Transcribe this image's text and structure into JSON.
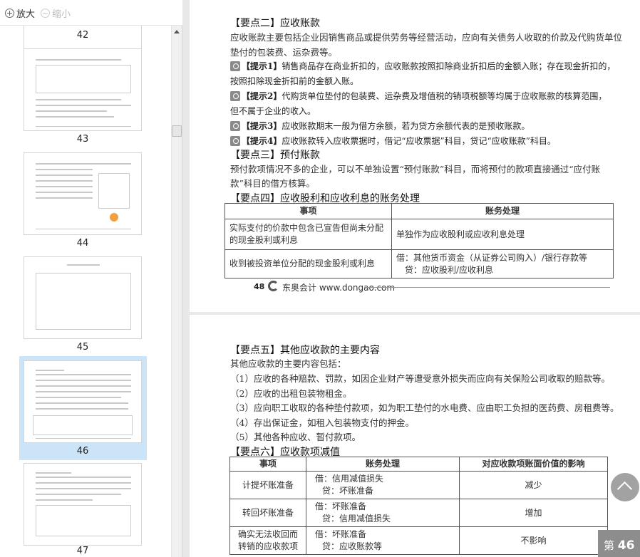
{
  "toolbar": {
    "zoom_in": "放大",
    "zoom_out": "缩小"
  },
  "thumbnails": [
    {
      "label": "42"
    },
    {
      "label": "43"
    },
    {
      "label": "44"
    },
    {
      "label": "45"
    },
    {
      "label": "46",
      "selected": true
    },
    {
      "label": "47"
    }
  ],
  "page48": {
    "h2": "【要点二】应收账款",
    "p2": [
      "应收账款主要包括企业因销售商品或提供劳务等经营活动，应向有关债务人收取的价款及代购货单位",
      "垫付的包装费、运杂费等。"
    ],
    "tips": [
      {
        "label": "【提示1】",
        "text": "销售商品存在商业折扣的，应收账款按照扣除商业折扣后的金额入账；存在现金折扣的，",
        "cont": "按照扣除现金折扣前的金额入账。"
      },
      {
        "label": "【提示2】",
        "text": "代购货单位垫付的包装费、运杂费及增值税的销项税额等均属于应收账款的核算范围，",
        "cont": "但不属于企业的收入。"
      },
      {
        "label": "【提示3】",
        "text": "应收账款期末一般为借方余额，若为贷方余额代表的是预收账款。"
      },
      {
        "label": "【提示4】",
        "text": "应收账款转入应收票据时，借记“应收票据”科目，贷记“应收账款”科目。"
      }
    ],
    "h3": "【要点三】预付账款",
    "p3": [
      "预付款项情况不多的企业，可以不单独设置“预付账款”科目，而将预付的款项直接通过“应付账",
      "款”科目的借方核算。"
    ],
    "h4": "【要点四】应收股利和应收利息的账务处理",
    "table": {
      "headers": [
        "事项",
        "账务处理"
      ],
      "rows": [
        [
          "实际支付的价款中包含已宣告但尚未分配的现金股利或利息",
          "单独作为应收股利或应收利息处理"
        ],
        [
          "收到被投资单位分配的现金股利或利息",
          "借：其他货币资金（从证券公司购入）/银行存款等",
          "贷：应收股利/应收利息"
        ]
      ]
    },
    "footer": {
      "page_no": "48",
      "brand": "东奥会计 www.dongao.com"
    }
  },
  "page49": {
    "h5": "【要点五】其他应收款的主要内容",
    "intro": "其他应收款的主要内容包括：",
    "items": [
      "（1）应收的各种赔款、罚款，如因企业财产等遭受意外损失而应向有关保险公司收取的赔款等。",
      "（2）应收的出租包装物租金。",
      "（3）应向职工收取的各种垫付款项，如为职工垫付的水电费、应由职工负担的医药费、房租费等。",
      "（4）存出保证金，如租入包装物支付的押金。",
      "（5）其他各种应收、暂付款项。"
    ],
    "h6": "【要点六】应收款项减值",
    "table": {
      "headers": [
        "事项",
        "账务处理",
        "对应收款项账面价值的影响"
      ],
      "rows": [
        [
          "计提坏账准备",
          "借：信用减值损失",
          "贷：坏账准备",
          "减少"
        ],
        [
          "转回坏账准备",
          "借：坏账准备",
          "贷：信用减值损失",
          "增加"
        ],
        [
          "确实无法收回而转销的应收款项",
          "借：坏账准备",
          "贷：应收账款等",
          "不影响"
        ]
      ]
    }
  },
  "page_indicator": {
    "prefix": "第",
    "current": "46"
  }
}
